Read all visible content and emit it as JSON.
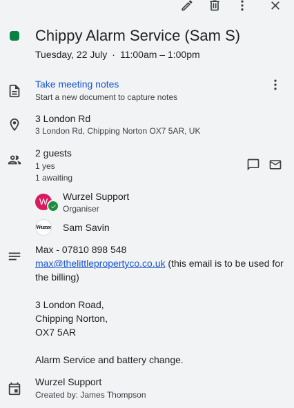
{
  "toolbar": {
    "edit_icon": "pencil-icon",
    "delete_icon": "trash-icon",
    "more_icon": "more-vert-icon",
    "close_icon": "close-icon"
  },
  "event": {
    "color": "#0b8043",
    "title": "Chippy Alarm Service (Sam S)",
    "date": "Tuesday, 22 July",
    "separator": "·",
    "time": "11:00am – 1:00pm"
  },
  "notes": {
    "icon": "document-icon",
    "label": "Take meeting notes",
    "sublabel": "Start a new document to capture notes",
    "more_icon": "more-vert-icon"
  },
  "location": {
    "icon": "location-pin-icon",
    "name": "3 London Rd",
    "address": "3 London Rd, Chipping Norton OX7 5AR, UK"
  },
  "guests": {
    "icon": "people-icon",
    "count_label": "2 guests",
    "yes_label": "1 yes",
    "awaiting_label": "1 awaiting",
    "chat_icon": "chat-icon",
    "email_icon": "email-icon",
    "list": [
      {
        "name": "Wurzel Support",
        "role": "Organiser",
        "avatar_letter": "W",
        "avatar_color": "#d81b60"
      },
      {
        "name": "Sam Savin",
        "role": "",
        "avatar_text": "WurzelW"
      }
    ]
  },
  "description": {
    "icon": "notes-lines-icon",
    "line1": "Max -  07810 898 548",
    "email": "max@thelittlepropertyco.co.uk",
    "email_suffix": " (this email is to be used for the billing)",
    "address_line1": "3 London Road,",
    "address_line2": "Chipping Norton,",
    "address_line3": "OX7 5AR",
    "note": "Alarm Service and battery change."
  },
  "calendar": {
    "icon": "calendar-icon",
    "name": "Wurzel Support",
    "created_by": "Created by: James Thompson"
  }
}
